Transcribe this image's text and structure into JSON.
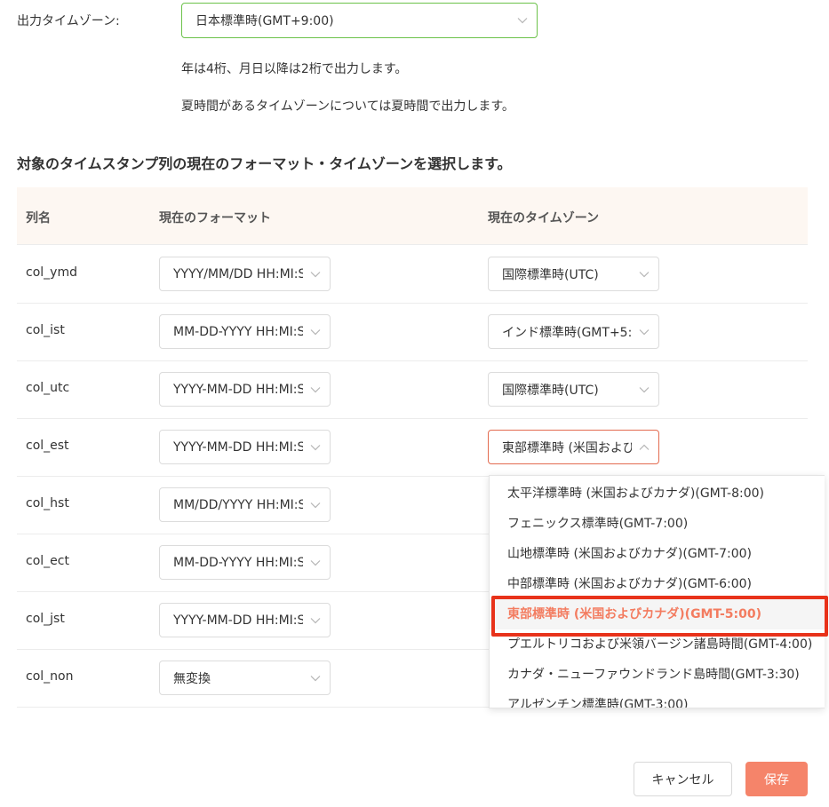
{
  "output_timezone": {
    "label": "出力タイムゾーン:",
    "value": "日本標準時(GMT+9:00)",
    "note1": "年は4桁、月日以降は2桁で出力します。",
    "note2": "夏時間があるタイムゾーンについては夏時間で出力します。"
  },
  "section_title": "対象のタイムスタンプ列の現在のフォーマット・タイムゾーンを選択します。",
  "table": {
    "headers": {
      "name": "列名",
      "format": "現在のフォーマット",
      "timezone": "現在のタイムゾーン"
    },
    "rows": [
      {
        "name": "col_ymd",
        "format": "YYYY/MM/DD HH:MI:S",
        "timezone": "国際標準時(UTC)"
      },
      {
        "name": "col_ist",
        "format": "MM-DD-YYYY HH:MI:S",
        "timezone": "インド標準時(GMT+5:3"
      },
      {
        "name": "col_utc",
        "format": "YYYY-MM-DD HH:MI:S",
        "timezone": "国際標準時(UTC)"
      },
      {
        "name": "col_est",
        "format": "YYYY-MM-DD HH:MI:S",
        "timezone": "東部標準時 (米国および"
      },
      {
        "name": "col_hst",
        "format": "MM/DD/YYYY HH:MI:S",
        "timezone": ""
      },
      {
        "name": "col_ect",
        "format": "MM-DD-YYYY HH:MI:S",
        "timezone": ""
      },
      {
        "name": "col_jst",
        "format": "YYYY-MM-DD HH:MI:S",
        "timezone": ""
      },
      {
        "name": "col_non",
        "format": "無変換",
        "timezone": ""
      }
    ]
  },
  "timezone_dropdown": {
    "options": [
      "太平洋標準時 (米国およびカナダ)(GMT-8:00)",
      "フェニックス標準時(GMT-7:00)",
      "山地標準時 (米国およびカナダ)(GMT-7:00)",
      "中部標準時 (米国およびカナダ)(GMT-6:00)",
      "東部標準時 (米国およびカナダ)(GMT-5:00)",
      "プエルトリコおよび米領バージン諸島時間(GMT-4:00)",
      "カナダ・ニューファウンドランド島時間(GMT-3:30)",
      "アルゼンチン標準時(GMT-3:00)"
    ],
    "selected_index": 4
  },
  "buttons": {
    "cancel": "キャンセル",
    "save": "保存"
  },
  "colors": {
    "accent": "#f5846a",
    "selected_text": "#f37c60",
    "focus_green": "#6cc24a",
    "highlight_red": "#e8321a"
  },
  "icons": {
    "select_arrow": "chevron-down-icon",
    "select_arrow_open": "chevron-up-icon"
  }
}
